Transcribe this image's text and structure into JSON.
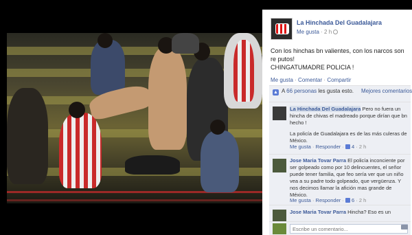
{
  "post": {
    "page_name": "La Hinchada Del Guadalajara",
    "like_label": "Me gusta",
    "separator": "·",
    "time": "2 h",
    "text_line1": "Con los hinchas bn valientes, con los narcos son re putos!",
    "text_line2": "CHINGATUMADRE POLICIA !",
    "actions": [
      "Me gusta",
      "Comentar",
      "Compartir"
    ]
  },
  "likes": {
    "prefix": "A",
    "count_text": "66 personas",
    "suffix": "les gusta esto.",
    "best_comments": "Mejores comentarios ▾"
  },
  "comments": [
    {
      "author": "La Hinchada Del Guadalajara",
      "text1": "Pero no fuera un hincha de chivas el madreado porque dirían que bn hecho !",
      "text2": "La policía de Guadalajara es de las más culeras de México.",
      "like": "Me gusta",
      "reply": "Responder",
      "likes": "4",
      "time": "2 h"
    },
    {
      "author": "Jose Maria Tovar Parra",
      "text1": "El policía inconciente por ser golpeado como por 10 delincuentes, el señor puede tener familia, que feo sería ver que un niño vea a su padre todo golpeado, que vergüenza. Y nos decimos llamar la afición mas grande de México.",
      "like": "Me gusta",
      "reply": "Responder",
      "likes": "6",
      "time": "2 h"
    },
    {
      "author": "Jose Maria Tovar Parra",
      "text1": "Hincha? Eso es un"
    }
  ],
  "composer": {
    "placeholder": "Escribe un comentario..."
  }
}
